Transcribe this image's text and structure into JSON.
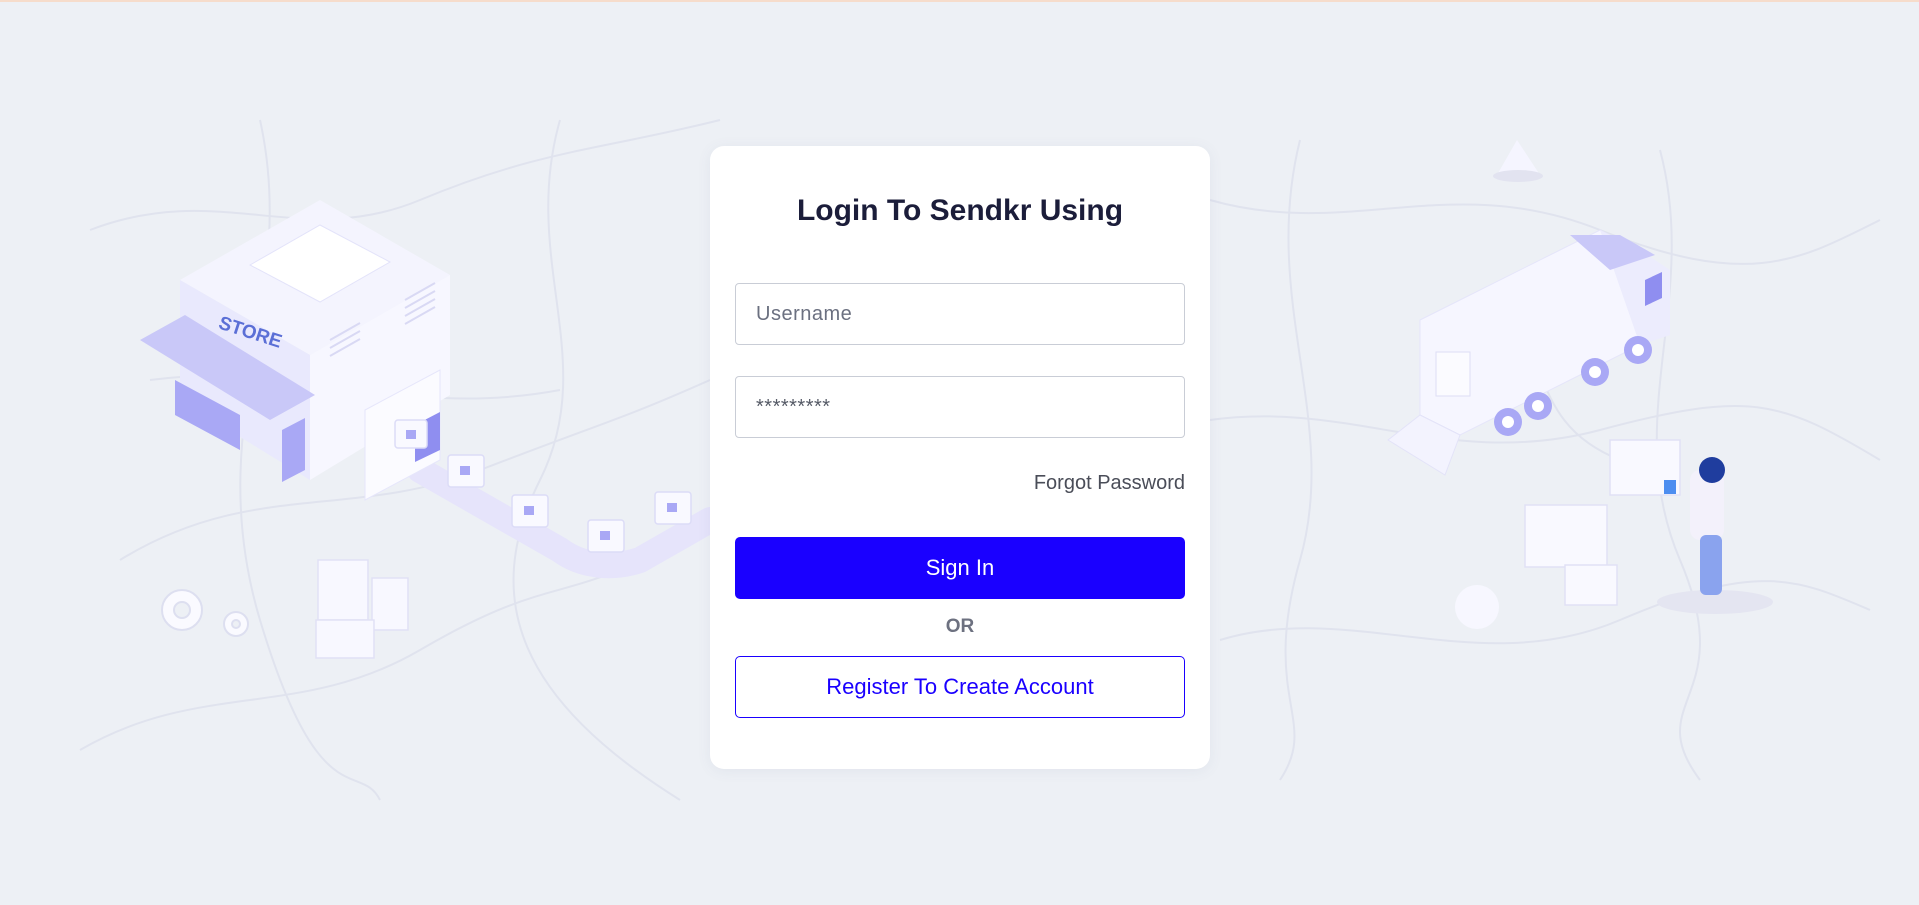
{
  "login": {
    "title": "Login To Sendkr Using",
    "username_placeholder": "Username",
    "password_value": "*********",
    "forgot_label": "Forgot Password",
    "signin_label": "Sign In",
    "or_label": "OR",
    "register_label": "Register To Create Account"
  },
  "illustration": {
    "store_sign": "STORE"
  },
  "colors": {
    "background": "#edf0f5",
    "primary": "#1a00ff",
    "title": "#1b1d3a",
    "illustration_accent": "#a9a8f5"
  }
}
